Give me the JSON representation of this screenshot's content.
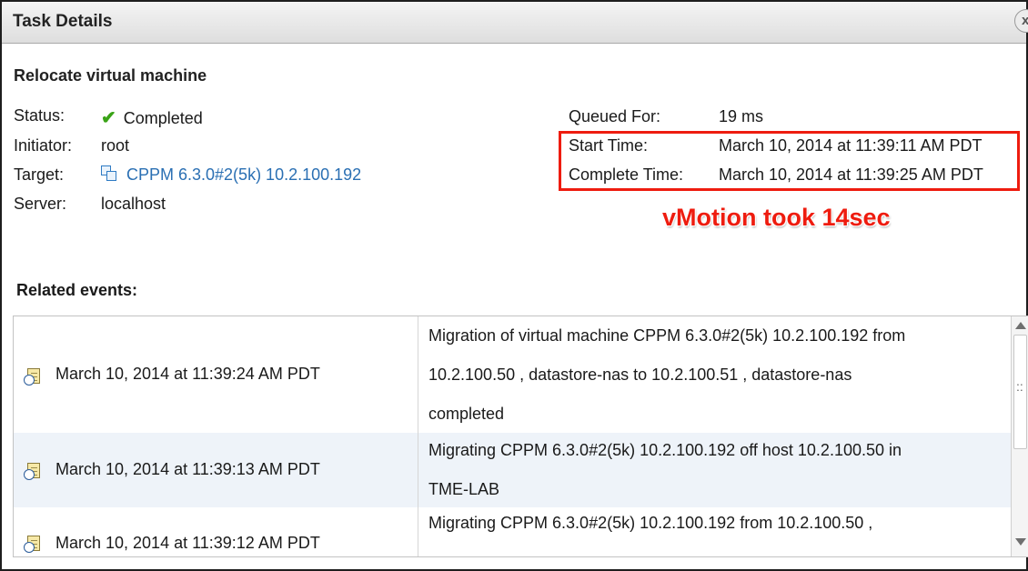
{
  "window": {
    "title": "Task Details",
    "close_label": "x"
  },
  "task": {
    "name": "Relocate virtual machine",
    "status_label": "Status:",
    "status_value": "Completed",
    "initiator_label": "Initiator:",
    "initiator_value": "root",
    "target_label": "Target:",
    "target_value": "CPPM 6.3.0#2(5k) 10.2.100.192",
    "server_label": "Server:",
    "server_value": "localhost",
    "queued_label": "Queued For:",
    "queued_value": "19 ms",
    "start_label": "Start Time:",
    "start_value": "March 10, 2014 at 11:39:11 AM PDT",
    "complete_label": "Complete Time:",
    "complete_value": "March 10, 2014 at 11:39:25 AM PDT"
  },
  "annotation": {
    "text": "vMotion took 14sec",
    "color": "#ee1c0f"
  },
  "related": {
    "title": "Related events:",
    "events": [
      {
        "time": "March 10, 2014 at 11:39:24 AM PDT",
        "lines": [
          "Migration of virtual machine  CPPM 6.3.0#2(5k) 10.2.100.192  from",
          "10.2.100.50 ,  datastore-nas  to  10.2.100.51 ,  datastore-nas",
          "completed"
        ]
      },
      {
        "time": "March 10, 2014 at 11:39:13 AM PDT",
        "lines": [
          "Migrating  CPPM 6.3.0#2(5k) 10.2.100.192  off host  10.2.100.50  in",
          "TME-LAB"
        ]
      },
      {
        "time": "March 10, 2014 at 11:39:12 AM PDT",
        "lines": [
          "Migrating  CPPM 6.3.0#2(5k) 10.2.100.192  from  10.2.100.50 ,"
        ]
      }
    ]
  },
  "icons": {
    "status": "check-icon",
    "target": "virtual-machine-icon",
    "event": "event-log-icon"
  },
  "colors": {
    "link": "#2a6fb3",
    "success": "#3aa317",
    "highlight": "#ee1c0f"
  }
}
